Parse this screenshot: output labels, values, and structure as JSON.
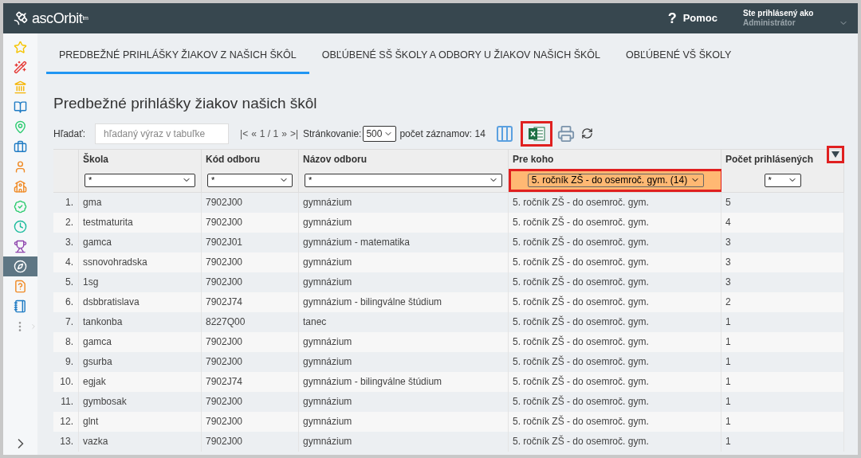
{
  "header": {
    "logo": "ascOrbit",
    "logo_mark": "tm",
    "help_icon": "?",
    "help": "Pomoc",
    "user_label": "Ste prihlásený ako",
    "user": "Administrátor"
  },
  "sidebar": {
    "items": [
      {
        "selected": false
      },
      {
        "selected": false
      },
      {
        "selected": false
      },
      {
        "selected": false
      },
      {
        "selected": false
      },
      {
        "selected": false
      },
      {
        "selected": false
      },
      {
        "selected": false
      },
      {
        "selected": false
      },
      {
        "selected": false
      },
      {
        "selected": false
      },
      {
        "selected": true
      },
      {
        "selected": false
      },
      {
        "selected": false
      }
    ]
  },
  "tabs": [
    {
      "label": "PREDBEŽNÉ PRIHLÁŠKY ŽIAKOV Z NAŠICH ŠKÔL",
      "selected": true
    },
    {
      "label": "OBĽÚBENÉ SŠ ŠKOLY A ODBORY U ŽIAKOV NAŠICH ŠKÔL",
      "selected": false
    },
    {
      "label": "OBĽÚBENÉ VŠ ŠKOLY",
      "selected": false
    }
  ],
  "page_title": "Predbežné prihlášky žiakov našich škôl",
  "toolbar": {
    "search_label": "Hľadať:",
    "search_placeholder": "hľadaný výraz v tabuľke",
    "pager": [
      "|<",
      "«",
      "1 / 1",
      "»",
      ">|"
    ],
    "paging_label": "Stránkovanie:",
    "paging_value": "500",
    "count": "počet záznamov: 14",
    "excel_highlighted": true
  },
  "table": {
    "menu_highlighted": true,
    "columns": [
      {},
      {
        "label": "Škola",
        "filter": "*",
        "filter_active": false,
        "highlighted": false
      },
      {
        "label": "Kód odboru",
        "filter": "*",
        "filter_active": false,
        "highlighted": false
      },
      {
        "label": "Názov odboru",
        "filter": "*",
        "filter_active": false,
        "highlighted": false
      },
      {
        "label": "Pre koho",
        "filter": "5. ročník ZŠ - do osemroč. gym. (14)",
        "filter_active": true,
        "highlighted": true
      },
      {
        "label": "Počet prihlásených",
        "filter": "*",
        "filter_active": false,
        "highlighted": false
      }
    ],
    "rows": [
      [
        "1.",
        "gma",
        "7902J00",
        "gymnázium",
        "5. ročník ZŠ - do osemroč. gym.",
        "5"
      ],
      [
        "2.",
        "testmaturita",
        "7902J00",
        "gymnázium",
        "5. ročník ZŠ - do osemroč. gym.",
        "4"
      ],
      [
        "3.",
        "gamca",
        "7902J01",
        "gymnázium - matematika",
        "5. ročník ZŠ - do osemroč. gym.",
        "3"
      ],
      [
        "4.",
        "ssnovohradska",
        "7902J00",
        "gymnázium",
        "5. ročník ZŠ - do osemroč. gym.",
        "3"
      ],
      [
        "5.",
        "1sg",
        "7902J00",
        "gymnázium",
        "5. ročník ZŠ - do osemroč. gym.",
        "3"
      ],
      [
        "6.",
        "dsbbratislava",
        "7902J74",
        "gymnázium - bilingválne štúdium",
        "5. ročník ZŠ - do osemroč. gym.",
        "2"
      ],
      [
        "7.",
        "tankonba",
        "8227Q00",
        "tanec",
        "5. ročník ZŠ - do osemroč. gym.",
        "1"
      ],
      [
        "8.",
        "gamca",
        "7902J00",
        "gymnázium",
        "5. ročník ZŠ - do osemroč. gym.",
        "1"
      ],
      [
        "9.",
        "gsurba",
        "7902J00",
        "gymnázium",
        "5. ročník ZŠ - do osemroč. gym.",
        "1"
      ],
      [
        "10.",
        "egjak",
        "7902J74",
        "gymnázium - bilingválne štúdium",
        "5. ročník ZŠ - do osemroč. gym.",
        "1"
      ],
      [
        "11.",
        "gymbosak",
        "7902J00",
        "gymnázium",
        "5. ročník ZŠ - do osemroč. gym.",
        "1"
      ],
      [
        "12.",
        "glnt",
        "7902J00",
        "gymnázium",
        "5. ročník ZŠ - do osemroč. gym.",
        "1"
      ],
      [
        "13.",
        "vazka",
        "7902J00",
        "gymnázium",
        "5. ročník ZŠ - do osemroč. gym.",
        "1"
      ]
    ]
  }
}
